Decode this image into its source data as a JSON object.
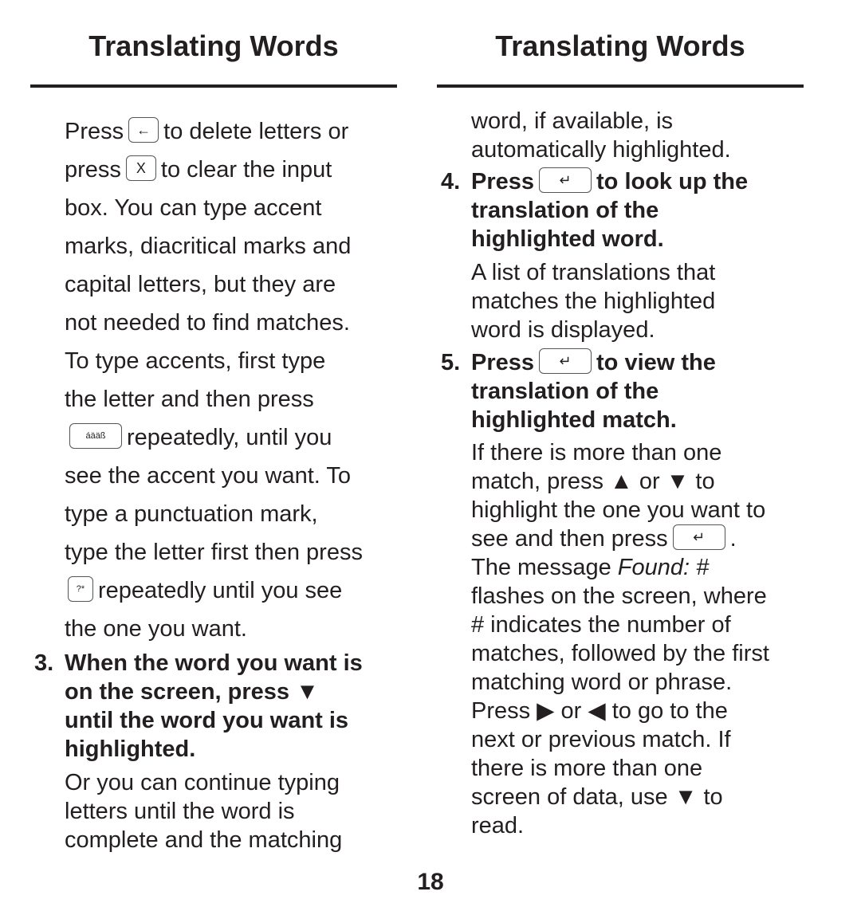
{
  "left_column": {
    "heading": "Translating Words",
    "intro": {
      "l1a": "Press",
      "l1b": "to delete letters or",
      "l2a": "press",
      "l2b": "to clear the input",
      "l3": "box. You can type accent",
      "l4": "marks, diacritical marks and",
      "l5": "capital letters, but they are",
      "l6": "not needed to find matches.",
      "l7": "To type accents, first type",
      "l8": "the letter and then press",
      "l9": "repeatedly, until you",
      "l10": "see the accent you want. To",
      "l11": "type a punctuation mark,",
      "l12": "type the letter first then press",
      "l13": "repeatedly until you see",
      "l14": "the one you want."
    },
    "keys": {
      "back": "←",
      "clear": "X",
      "accent": "áääß",
      "punct": "?*"
    },
    "step3": {
      "number": "3.",
      "l1": "When the word you want is",
      "l2": "on the screen, press ▼",
      "l3": "until the word you want is",
      "l4": "highlighted.",
      "p1": "Or you can continue typing",
      "p2": "letters until the word is",
      "p3": "complete and the matching"
    }
  },
  "right_column": {
    "heading": "Translating Words",
    "cont1": "word, if available, is",
    "cont2": "automatically highlighted.",
    "step4": {
      "number": "4.",
      "l1a": "Press",
      "l1b": "to look up the",
      "l2": "translation of the",
      "l3": "highlighted word.",
      "p1": "A list of translations that",
      "p2": "matches the highlighted",
      "p3": "word is displayed."
    },
    "step5": {
      "number": "5.",
      "l1a": "Press",
      "l1b": "to view the",
      "l2": "translation of the",
      "l3": "highlighted match.",
      "p1": "If there is more than one",
      "p2": "match, press ▲ or ▼ to",
      "p3": "highlight the one you want to",
      "p4": "see and then press",
      "p5a": "The message",
      "p5b": "Found: #",
      "p6": "flashes on the screen, where",
      "p7": "# indicates the number of",
      "p8": "matches, followed by the first",
      "p9": "matching word or phrase.",
      "p10": "Press ▶ or ◀ to go to the",
      "p11": "next or previous match. If",
      "p12": "there is more than one",
      "p13": "screen of data, use ▼ to",
      "p14": "read."
    },
    "enter_key": "↵"
  },
  "page_number": "18"
}
